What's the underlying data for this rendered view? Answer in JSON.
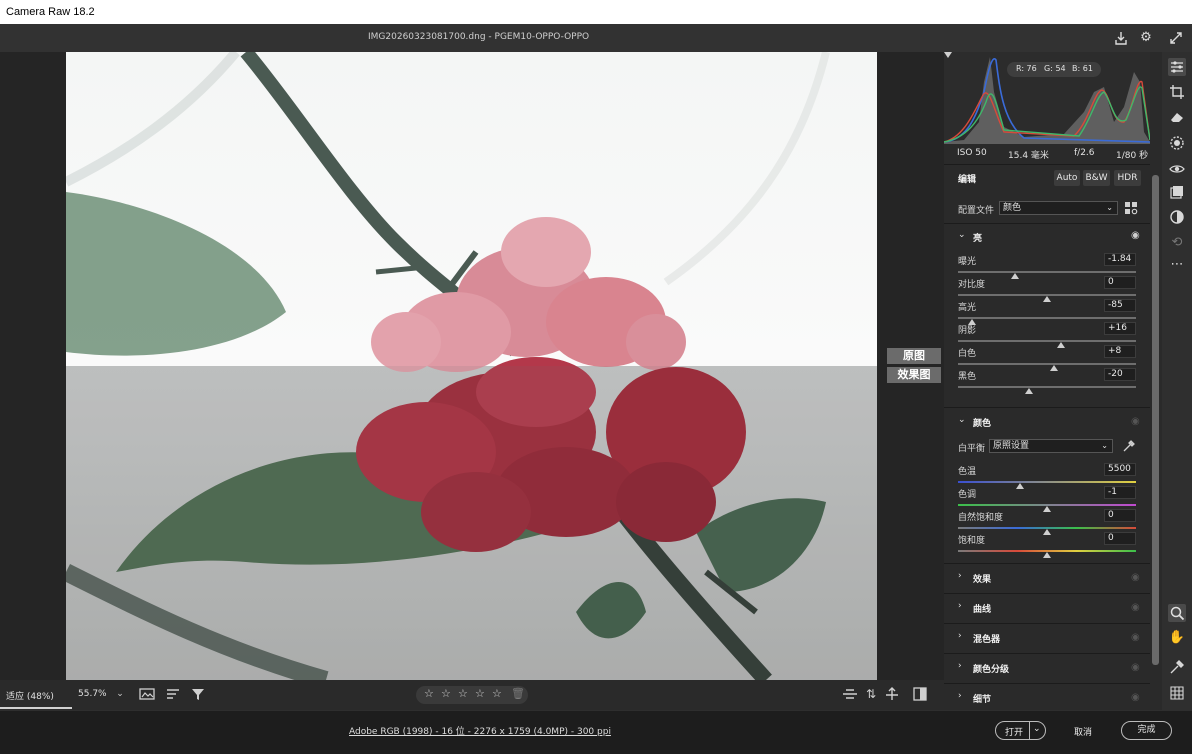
{
  "window": {
    "title": "Camera Raw 18.2"
  },
  "file": {
    "name": "IMG20260323081700.dng - PGEM10-OPPO-OPPO"
  },
  "header_icons": [
    "save-download-icon",
    "gear-icon",
    "fullscreen-icon"
  ],
  "compare_labels": {
    "before": "原图",
    "after": "效果图"
  },
  "bottom": {
    "zoom_fit": "适应 (48%)",
    "zoom_pct": "55.7%",
    "rating_stars": 0
  },
  "status": {
    "workflow": "Adobe RGB (1998) - 16 位 - 2276 x 1759 (4.0MP) - 300 ppi",
    "open": "打开",
    "cancel": "取消",
    "done": "完成"
  },
  "histogram": {
    "readout": {
      "r": "R: 76",
      "g": "G: 54",
      "b": "B: 61"
    }
  },
  "exif": {
    "iso": "ISO 50",
    "focal": "15.4 毫米",
    "aperture": "f/2.6",
    "shutter": "1/80 秒"
  },
  "edit": {
    "title": "编辑",
    "buttons": [
      "Auto",
      "B&W",
      "HDR"
    ],
    "profile_label": "配置文件",
    "profile_value": "颜色"
  },
  "light": {
    "title": "亮",
    "sliders": [
      {
        "label": "曝光",
        "value": "-1.84",
        "pos": 0.32
      },
      {
        "label": "对比度",
        "value": "0",
        "pos": 0.5
      },
      {
        "label": "高光",
        "value": "-85",
        "pos": 0.08
      },
      {
        "label": "阴影",
        "value": "+16",
        "pos": 0.58
      },
      {
        "label": "白色",
        "value": "+8",
        "pos": 0.54
      },
      {
        "label": "黑色",
        "value": "-20",
        "pos": 0.4
      }
    ]
  },
  "color": {
    "title": "颜色",
    "wb_label": "白平衡",
    "wb_value": "原照设置",
    "sliders": [
      {
        "label": "色温",
        "value": "5500",
        "pos": 0.35
      },
      {
        "label": "色调",
        "value": "-1",
        "pos": 0.5
      },
      {
        "label": "自然饱和度",
        "value": "0",
        "pos": 0.5
      },
      {
        "label": "饱和度",
        "value": "0",
        "pos": 0.5
      }
    ]
  },
  "collapsed_sections": [
    "效果",
    "曲线",
    "混色器",
    "颜色分级",
    "细节"
  ],
  "tools": [
    "edit-sliders-icon",
    "crop-icon",
    "eraser-icon",
    "masking-icon",
    "red-eye-icon",
    "presets-icon",
    "snapshots-icon",
    "retouch-icon",
    "more-icon",
    "zoom-icon",
    "hand-icon",
    "color-sampler-icon",
    "grid-overlay-icon"
  ]
}
